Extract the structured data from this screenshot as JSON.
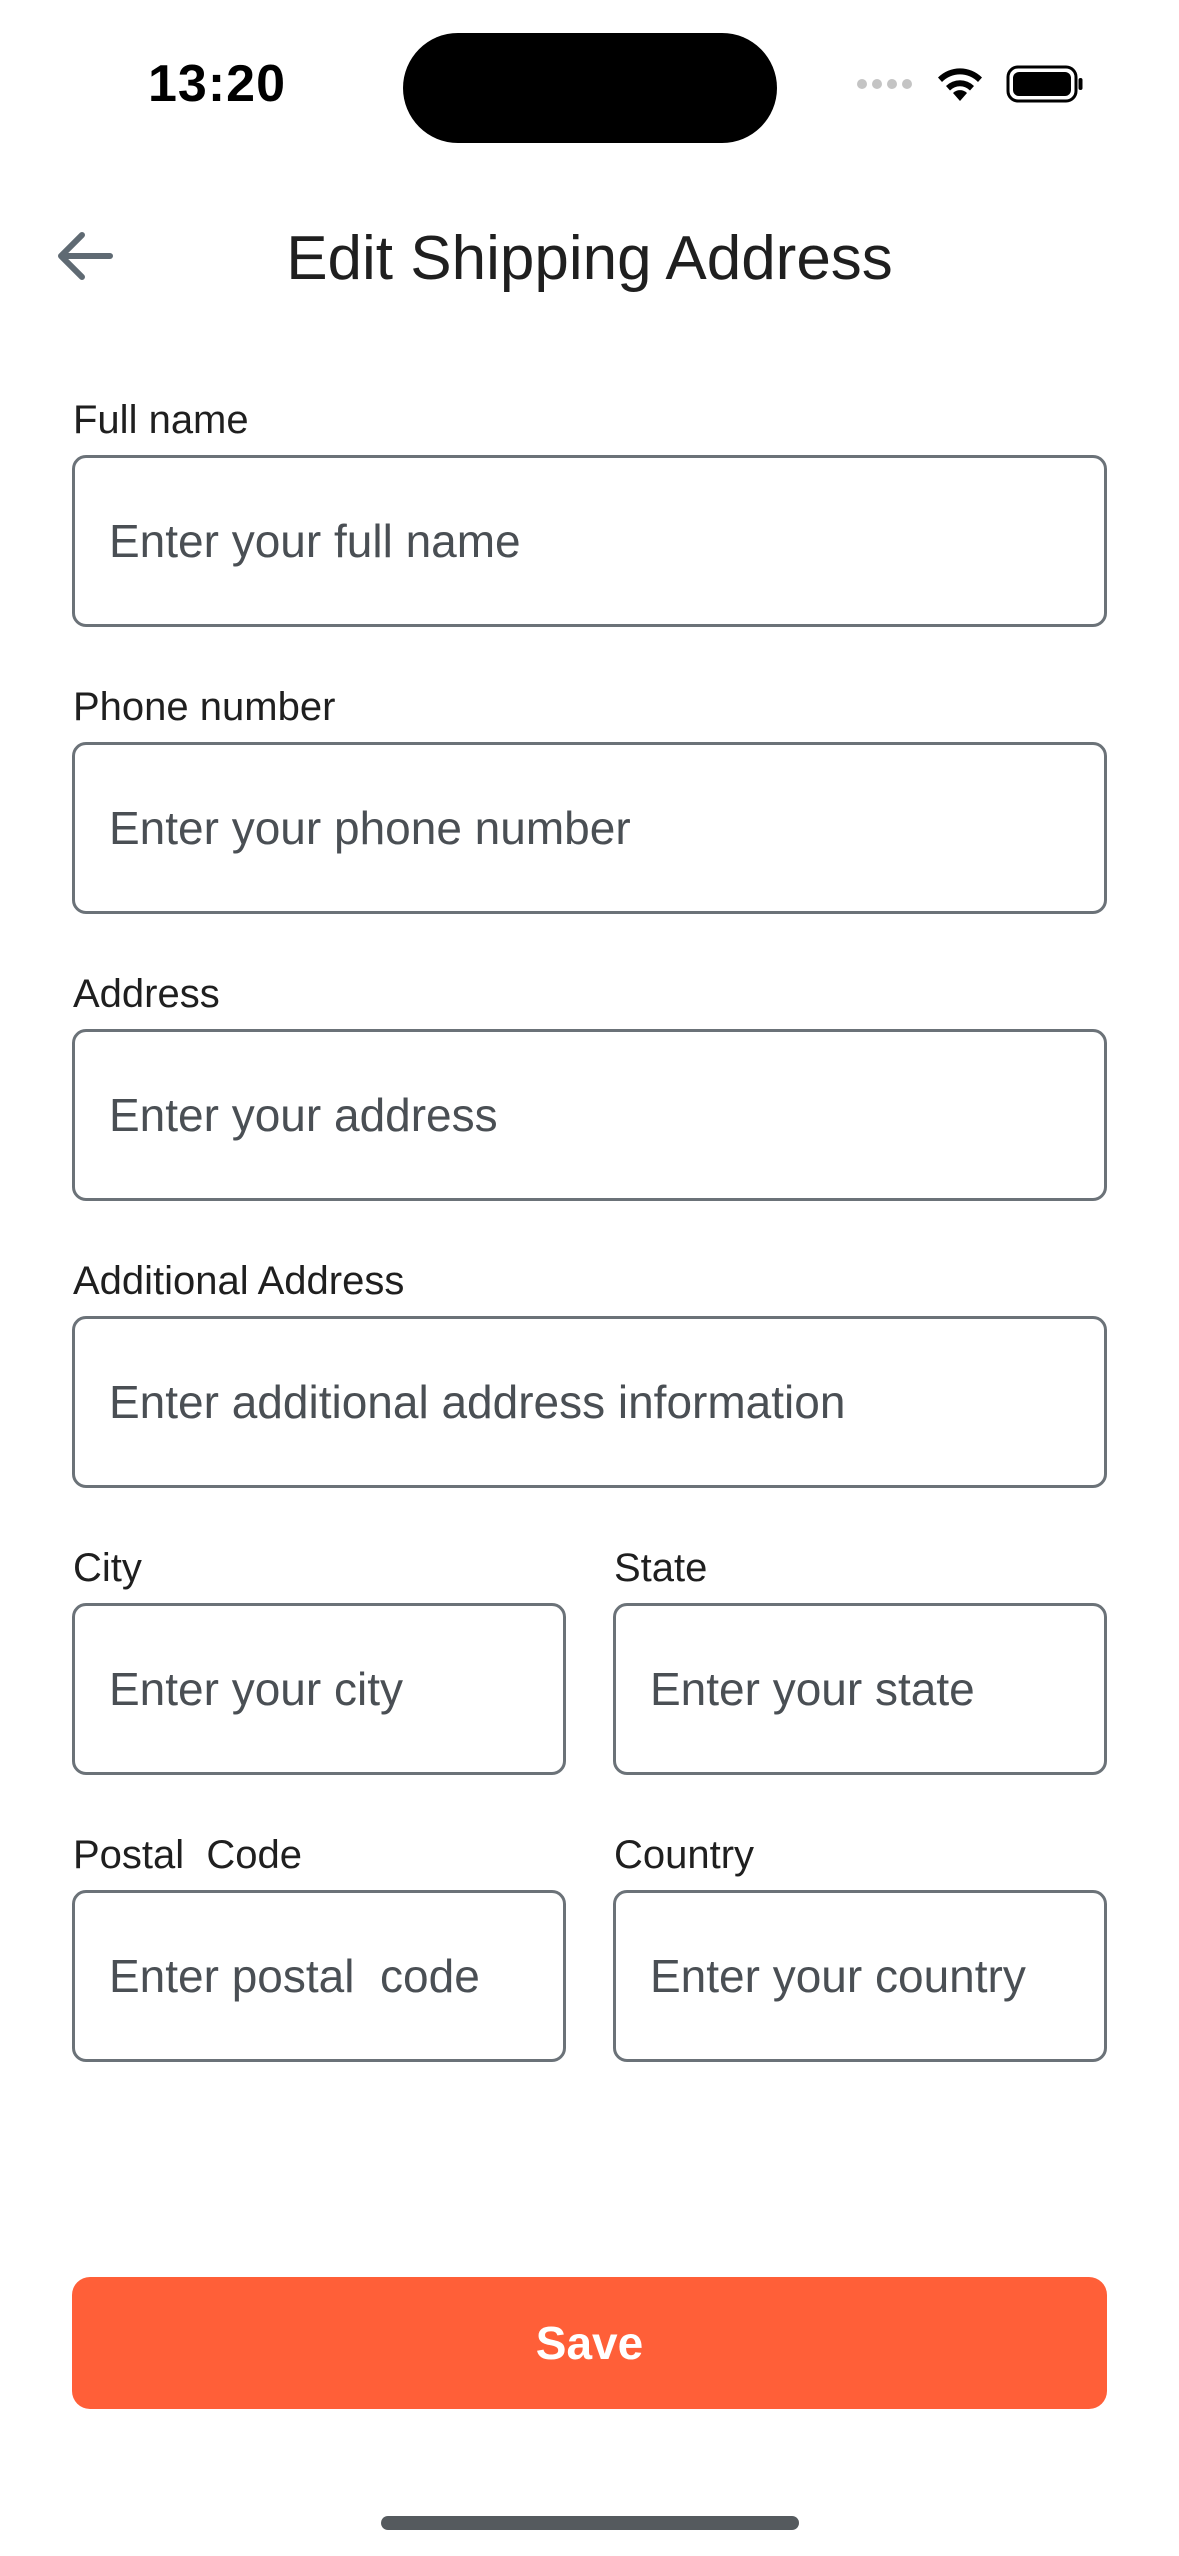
{
  "status_bar": {
    "time": "13:20",
    "icons": [
      "signal-dots-icon",
      "wifi-icon",
      "battery-icon"
    ]
  },
  "header": {
    "title": "Edit Shipping Address",
    "back_icon": "arrow-left-icon"
  },
  "form": {
    "full_name": {
      "label": "Full name",
      "placeholder": "Enter your full name",
      "value": ""
    },
    "phone": {
      "label": "Phone number",
      "placeholder": "Enter your phone number",
      "value": ""
    },
    "address": {
      "label": "Address",
      "placeholder": "Enter your address",
      "value": ""
    },
    "additional_address": {
      "label": "Additional Address",
      "placeholder": "Enter additional address information",
      "value": ""
    },
    "city": {
      "label": "City",
      "placeholder": "Enter your city",
      "value": ""
    },
    "state": {
      "label": "State",
      "placeholder": "Enter your state",
      "value": ""
    },
    "postal_code": {
      "label": "Postal  Code",
      "placeholder": "Enter postal  code",
      "value": ""
    },
    "country": {
      "label": "Country",
      "placeholder": "Enter your country",
      "value": ""
    }
  },
  "actions": {
    "save_label": "Save"
  },
  "colors": {
    "accent": "#ff5f38",
    "input_border": "#6b7278",
    "text": "#1f1f1f"
  }
}
